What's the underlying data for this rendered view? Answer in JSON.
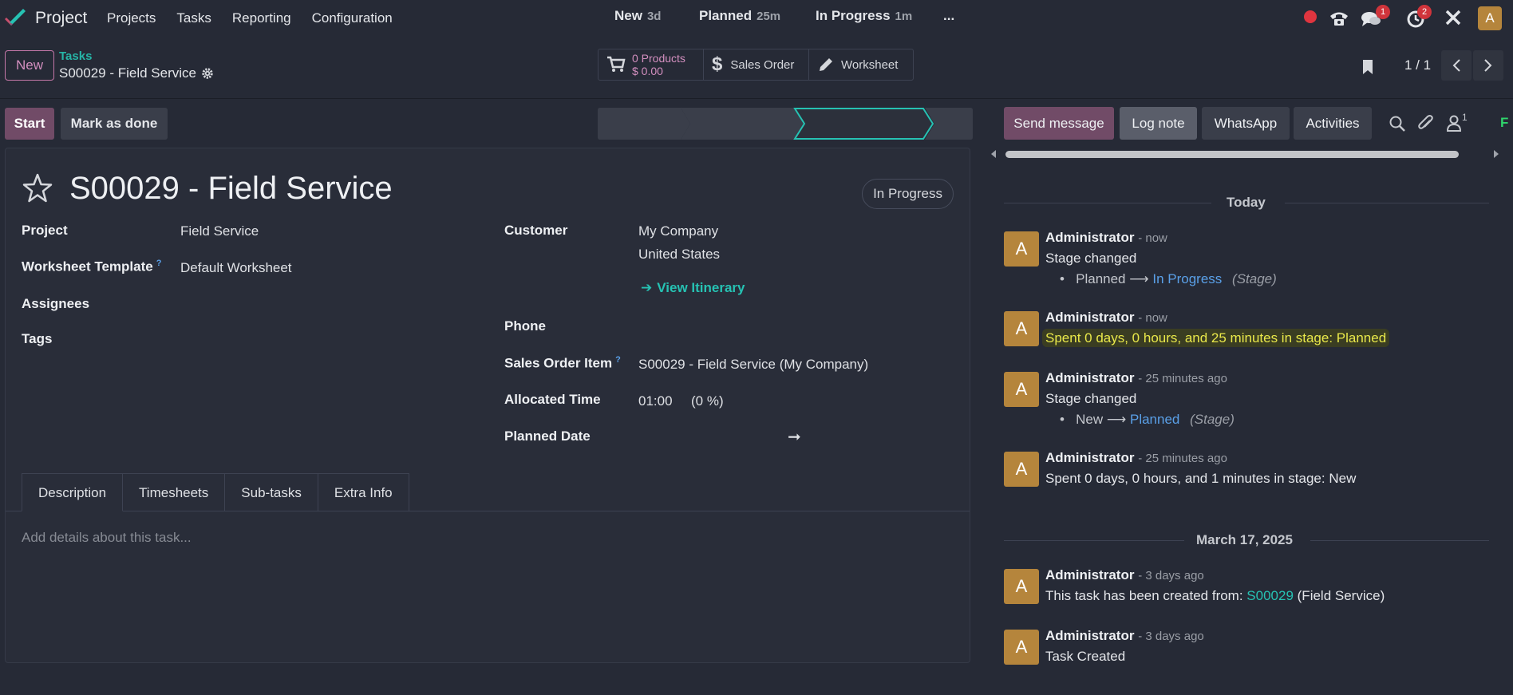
{
  "navbar": {
    "app_name": "Project",
    "menu": [
      "Projects",
      "Tasks",
      "Reporting",
      "Configuration"
    ],
    "messages_count": "1",
    "activities_count": "2",
    "user_initial": "A"
  },
  "control": {
    "new_label": "New",
    "breadcrumb_parent": "Tasks",
    "record_title": "S00029 - Field Service",
    "smart_buttons": {
      "products_count": "0 Products",
      "products_amount": "$ 0.00",
      "sales_order": "Sales Order",
      "worksheet": "Worksheet"
    },
    "pager": "1 / 1"
  },
  "actions": {
    "start": "Start",
    "mark_done": "Mark as done"
  },
  "stages": [
    {
      "label": "New",
      "time": "3d"
    },
    {
      "label": "Planned",
      "time": "25m"
    },
    {
      "label": "In Progress",
      "time": "1m"
    },
    {
      "label": "..."
    }
  ],
  "form": {
    "title": "S00029 - Field Service",
    "status_badge": "In Progress",
    "left": {
      "project_label": "Project",
      "project_value": "Field Service",
      "worksheet_label": "Worksheet Template",
      "worksheet_value": "Default Worksheet",
      "assignees_label": "Assignees",
      "tags_label": "Tags"
    },
    "right": {
      "customer_label": "Customer",
      "customer_line1": "My Company",
      "customer_line2": "United States",
      "view_itinerary": "View Itinerary",
      "phone_label": "Phone",
      "so_item_label": "Sales Order Item",
      "so_item_value": "S00029 - Field Service (My Company)",
      "allocated_label": "Allocated Time",
      "allocated_value": "01:00",
      "allocated_pct": "(0 %)",
      "planned_label": "Planned Date"
    },
    "help_marker": "?",
    "tabs": [
      "Description",
      "Timesheets",
      "Sub-tasks",
      "Extra Info"
    ],
    "description_placeholder": "Add details about this task..."
  },
  "chatter": {
    "buttons": {
      "send_message": "Send message",
      "log_note": "Log note",
      "whatsapp": "WhatsApp",
      "activities": "Activities",
      "followers_count": "1",
      "cut_label": "F"
    },
    "day_today": "Today",
    "day_march": "March 17, 2025",
    "messages": [
      {
        "author": "Administrator",
        "time": "- now",
        "body": "Stage changed",
        "from": "Planned",
        "to": "In Progress",
        "field": "(Stage)"
      },
      {
        "author": "Administrator",
        "time": "- now",
        "body": "Spent 0 days, 0 hours, and 25 minutes in stage: Planned"
      },
      {
        "author": "Administrator",
        "time": "- 25 minutes ago",
        "body": "Stage changed",
        "from": "New",
        "to": "Planned",
        "field": "(Stage)"
      },
      {
        "author": "Administrator",
        "time": "- 25 minutes ago",
        "body": "Spent 0 days, 0 hours, and 1 minutes in stage: New"
      },
      {
        "author": "Administrator",
        "time": "- 3 days ago",
        "body_prefix": "This task has been created from: ",
        "link": "S00029",
        "body_suffix": " (Field Service)"
      },
      {
        "author": "Administrator",
        "time": "- 3 days ago",
        "body": "Task Created"
      }
    ],
    "avatar_initial": "A",
    "arrow": "⟶"
  },
  "colors": {
    "background": "#262a36",
    "primary": "#714b67",
    "teal": "#26c2b3",
    "avatar": "#b5853c",
    "badge": "#d0343b"
  }
}
